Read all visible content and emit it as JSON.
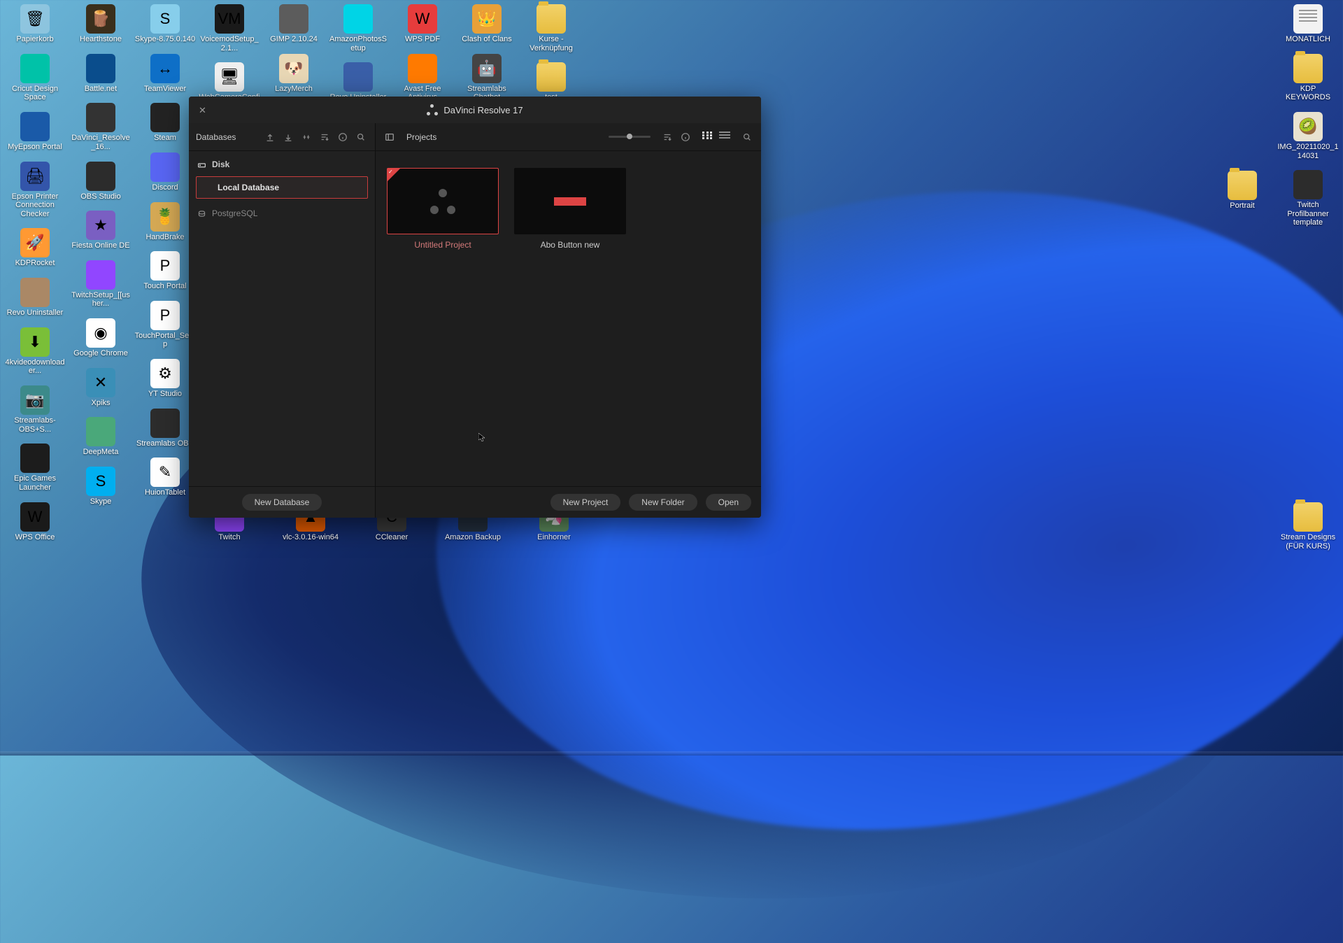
{
  "desktop": {
    "cols": {
      "col0": [
        {
          "cls": "trash",
          "glyph": "🗑",
          "label": "Papierkorb"
        },
        {
          "cls": "cricut",
          "glyph": "",
          "label": "Cricut Design Space"
        },
        {
          "cls": "epson",
          "glyph": "",
          "label": "MyEpson Portal"
        },
        {
          "cls": "printer",
          "glyph": "🖨",
          "label": "Epson Printer Connection Checker"
        },
        {
          "cls": "kdp",
          "glyph": "🚀",
          "label": "KDPRocket"
        },
        {
          "cls": "revoold",
          "glyph": "",
          "label": "Revo Uninstaller"
        },
        {
          "cls": "dlgreen",
          "glyph": "⬇",
          "label": "4kvideodownloader..."
        },
        {
          "cls": "cam",
          "glyph": "📷",
          "label": "Streamlabs-OBS+S..."
        },
        {
          "cls": "epic",
          "glyph": "",
          "label": "Epic Games Launcher"
        },
        {
          "cls": "wps",
          "glyph": "W",
          "label": "WPS Office"
        }
      ],
      "col1": [
        {
          "cls": "hearth",
          "glyph": "🪵",
          "label": "Hearthstone"
        },
        {
          "cls": "battlenet",
          "glyph": "",
          "label": "Battle.net"
        },
        {
          "cls": "dvr",
          "glyph": "",
          "label": "DaVinci_Resolve_16..."
        },
        {
          "cls": "obs",
          "glyph": "",
          "label": "OBS Studio"
        },
        {
          "cls": "fiesta",
          "glyph": "★",
          "label": "Fiesta Online DE"
        },
        {
          "cls": "twitchs",
          "glyph": "",
          "label": "TwitchSetup_[[usher..."
        },
        {
          "cls": "chrome",
          "glyph": "◉",
          "label": "Google Chrome"
        },
        {
          "cls": "xpiks",
          "glyph": "✕",
          "label": "Xpiks"
        },
        {
          "cls": "deepmeta",
          "glyph": "",
          "label": "DeepMeta"
        },
        {
          "cls": "skype2",
          "glyph": "S",
          "label": "Skype"
        }
      ],
      "col2": [
        {
          "cls": "skype-old",
          "glyph": "S",
          "label": "Skype-8.75.0.140"
        },
        {
          "cls": "teamviewer",
          "glyph": "↔",
          "label": "TeamViewer"
        },
        {
          "cls": "steam",
          "glyph": "",
          "label": "Steam"
        },
        {
          "cls": "discord",
          "glyph": "",
          "label": "Discord"
        },
        {
          "cls": "handbrake",
          "glyph": "🍍",
          "label": "HandBrake"
        },
        {
          "cls": "touch",
          "glyph": "P",
          "label": "Touch Portal"
        },
        {
          "cls": "touch2",
          "glyph": "P",
          "label": "TouchPortal_Setup"
        },
        {
          "cls": "yt",
          "glyph": "⚙",
          "label": "YT Studio"
        },
        {
          "cls": "slobsobs",
          "glyph": "",
          "label": "Streamlabs OBS"
        },
        {
          "cls": "huion",
          "glyph": "✎",
          "label": "HuionTablet"
        }
      ],
      "col3": [
        {
          "cls": "dark",
          "glyph": "VM",
          "label": "VoicemodSetup_2.1..."
        },
        {
          "cls": "whitebg",
          "glyph": "🖥",
          "label": "WebCameraConfig"
        }
      ],
      "col4": [
        {
          "cls": "gimp",
          "glyph": "",
          "label": "GIMP 2.10.24"
        },
        {
          "cls": "lazy",
          "glyph": "🐶",
          "label": "LazyMerch"
        }
      ],
      "col5": [
        {
          "cls": "photos",
          "glyph": "",
          "label": "AmazonPhotosSetup"
        },
        {
          "cls": "revo",
          "glyph": "",
          "label": "Revo Uninstaller"
        }
      ],
      "col6": [
        {
          "cls": "red",
          "glyph": "W",
          "label": "WPS PDF"
        },
        {
          "cls": "avast",
          "glyph": "",
          "label": "Avast Free Antivirus"
        }
      ],
      "col7": [
        {
          "cls": "clash",
          "glyph": "👑",
          "label": "Clash of Clans"
        },
        {
          "cls": "stream",
          "glyph": "🤖",
          "label": "Streamlabs Chatbot"
        }
      ],
      "col8": [
        {
          "cls": "folder",
          "glyph": "",
          "label": "Kurse - Verknüpfung"
        },
        {
          "cls": "folder",
          "glyph": "",
          "label": "test"
        }
      ],
      "colR0": [
        {
          "cls": "txt",
          "glyph": "",
          "label": "MONATLICH"
        },
        {
          "cls": "folder",
          "glyph": "",
          "label": "KDP KEYWORDS"
        },
        {
          "cls": "img",
          "glyph": "🥝",
          "label": "IMG_20211020_114031"
        },
        {
          "cls": "twbanner",
          "glyph": "",
          "label": "Twitch Profilbanner template"
        }
      ],
      "colR1": [
        {
          "cls": "folder",
          "glyph": "",
          "label": "Portrait"
        }
      ],
      "bottomRow": [
        {
          "cls": "twitch",
          "glyph": "",
          "label": "Twitch"
        },
        {
          "cls": "vlc",
          "glyph": "▲",
          "label": "vlc-3.0.16-win64"
        },
        {
          "cls": "cc",
          "glyph": "C",
          "label": "CCleaner"
        },
        {
          "cls": "az",
          "glyph": "",
          "label": "Amazon Backup"
        },
        {
          "cls": "ein",
          "glyph": "🦄",
          "label": "Einhorner"
        }
      ],
      "colR0_extra": [
        {
          "cls": "folder",
          "glyph": "",
          "label": "Stream Designs (FÜR KURS)"
        }
      ]
    }
  },
  "pm": {
    "title": "DaVinci Resolve 17",
    "left": {
      "header": "Databases",
      "disk_label": "Disk",
      "local_db": "Local Database",
      "pg_label": "PostgreSQL",
      "new_db_btn": "New Database"
    },
    "right": {
      "header": "Projects",
      "new_project_btn": "New Project",
      "new_folder_btn": "New Folder",
      "open_btn": "Open",
      "projects": [
        {
          "name": "Untitled Project",
          "selected": true
        },
        {
          "name": "Abo Button new",
          "selected": false
        }
      ]
    }
  }
}
